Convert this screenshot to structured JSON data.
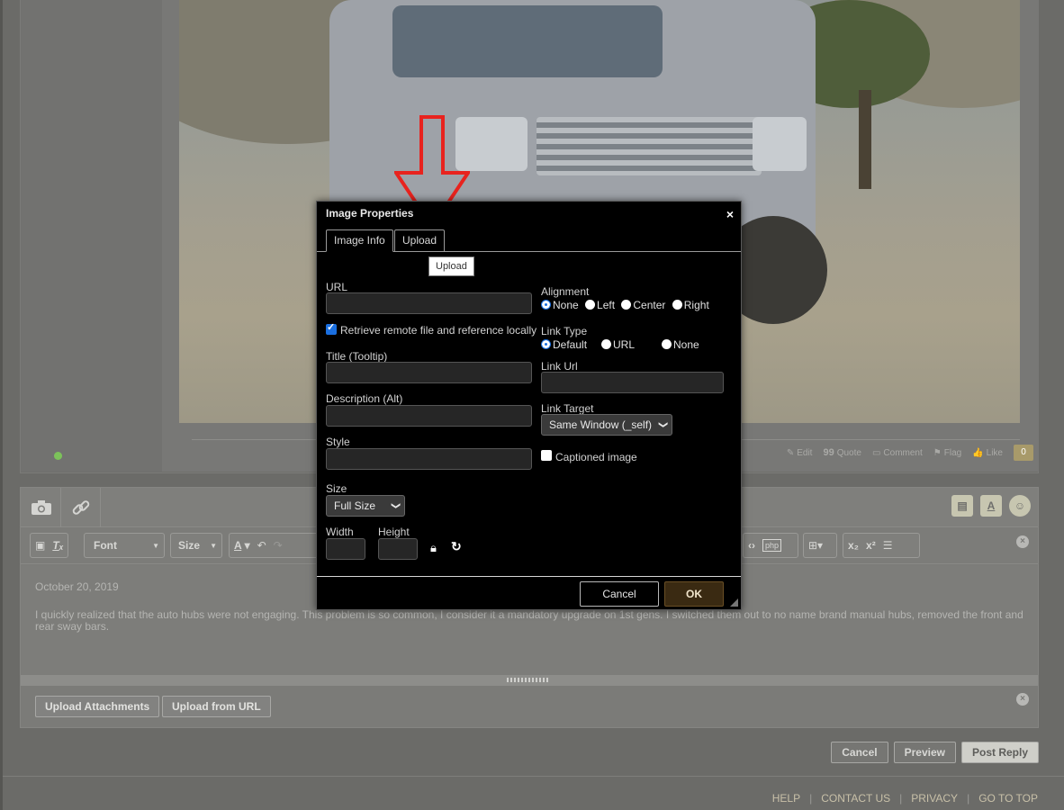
{
  "post": {
    "actions": {
      "edit": "Edit",
      "quote": "Quote",
      "comment": "Comment",
      "flag": "Flag",
      "like": "Like",
      "like_count": "0"
    }
  },
  "editor": {
    "toolbar": {
      "font": "Font",
      "size": "Size"
    },
    "content": {
      "date": "October 20, 2019",
      "body": "I quickly realized that the auto hubs were not engaging. This problem is so common, I consider it a mandatory upgrade on 1st gens. I switched them out to no name brand manual hubs, removed the front and rear sway bars."
    },
    "attachments": {
      "upload_attachments": "Upload Attachments",
      "upload_from_url": "Upload from URL"
    }
  },
  "reply": {
    "cancel": "Cancel",
    "preview": "Preview",
    "post_reply": "Post Reply"
  },
  "footer": {
    "links": [
      "HELP",
      "CONTACT US",
      "PRIVACY",
      "GO TO TOP"
    ]
  },
  "dialog": {
    "title": "Image Properties",
    "close": "×",
    "tabs": [
      "Image Info",
      "Upload"
    ],
    "tooltip": "Upload",
    "url_label": "URL",
    "url_value": "",
    "retrieve_label": "Retrieve remote file and reference locally",
    "retrieve_checked": true,
    "title_label": "Title (Tooltip)",
    "description_label": "Description (Alt)",
    "style_label": "Style",
    "size_label": "Size",
    "size_value": "Full Size",
    "width_label": "Width",
    "height_label": "Height",
    "alignment_label": "Alignment",
    "alignment_options": [
      "None",
      "Left",
      "Center",
      "Right"
    ],
    "alignment_selected": "None",
    "link_type_label": "Link Type",
    "link_type_options": [
      "Default",
      "URL",
      "None"
    ],
    "link_type_selected": "Default",
    "link_url_label": "Link Url",
    "link_target_label": "Link Target",
    "link_target_value": "Same Window (_self)",
    "captioned_label": "Captioned image",
    "captioned_checked": false,
    "cancel": "Cancel",
    "ok": "OK"
  },
  "colors": {
    "arrow": "#e8231e",
    "ok_bg": "#3a2a12",
    "checkbox_blue": "#1a6fe0",
    "footer_link": "#c8c0a8"
  }
}
